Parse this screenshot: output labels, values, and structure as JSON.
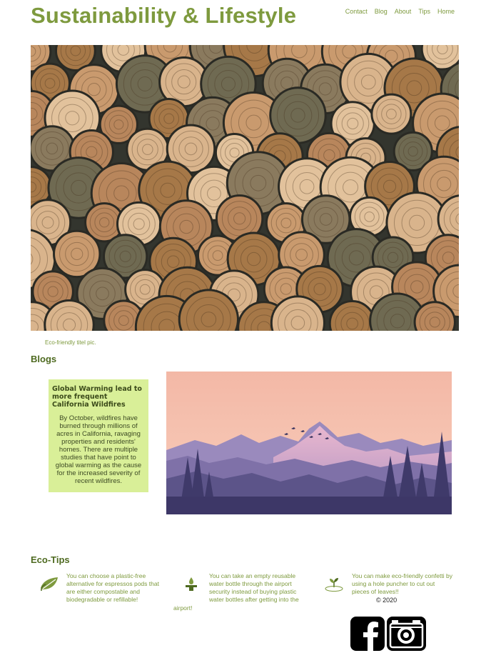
{
  "header": {
    "title": "Sustainability & Lifestyle",
    "nav": [
      "Contact",
      "Blog",
      "About",
      "Tips",
      "Home"
    ]
  },
  "hero": {
    "caption": "Eco-friendly titel pic."
  },
  "blogs": {
    "heading": "Blogs",
    "card_title": "Global Warming lead to more frequent California Wildfires",
    "card_text": "By October, wildfires have burned through millions of acres in California, ravaging properties and residents' homes. There are multiple studies that have point to global warming as the cause for the increased severity of recent wildfires."
  },
  "tips": {
    "heading": "Eco-Tips",
    "items": [
      {
        "icon": "leaf-recycle-icon",
        "text": "You can choose a plastic-free alternative for espressos pods that are either compostable and biodegradable or refillable!"
      },
      {
        "icon": "water-tap-icon",
        "text_part1": "You can take an empty reusable water bottle through the airport security instead of buying plastic water bottles after getting into the",
        "text_part2": "airport!"
      },
      {
        "icon": "plant-sprout-icon",
        "text": "You can make eco-friendly confetti by using a hole puncher to cut out pieces of leaves!!"
      }
    ]
  },
  "footer": {
    "copyright": "© 2020",
    "social": [
      "facebook-icon",
      "camera-icon"
    ]
  },
  "colors": {
    "accent": "#7e9a3e",
    "card_bg": "#d9ef98",
    "heading": "#4e6a20"
  }
}
